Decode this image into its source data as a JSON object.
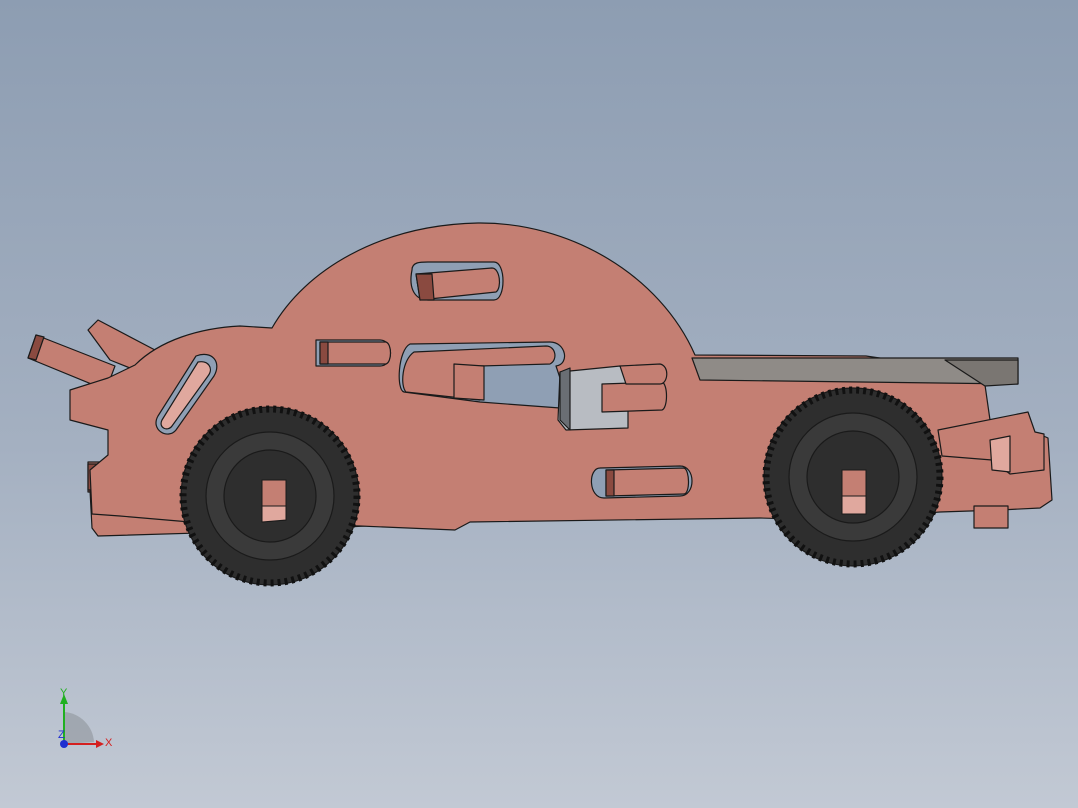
{
  "viewport": {
    "model": "toy-car-assembly",
    "colors": {
      "background_top": "#8d9db2",
      "background_bottom": "#c2c9d4",
      "body": "#c47f73",
      "body_light": "#e0a89e",
      "body_dark": "#8a4a40",
      "tire": "#2e2e2e",
      "tire_tread": "#1e1e1e",
      "hub": "#3a3a3a",
      "rail": "#8f8b87",
      "clip": "#b8bcc2",
      "outline": "#1a1a1a"
    }
  },
  "triad": {
    "x_label": "X",
    "y_label": "Y",
    "z_label": "Z",
    "colors": {
      "x": "#d42020",
      "y": "#20b020",
      "z": "#2030d0"
    }
  }
}
